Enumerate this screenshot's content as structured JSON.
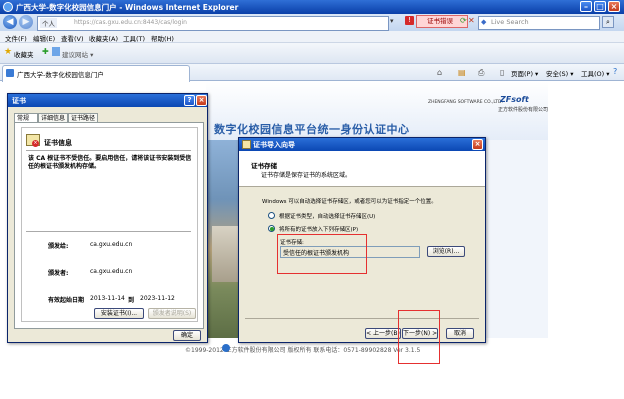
{
  "browser": {
    "title": "广西大学-数字化校园信息门户 - Windows Internet Explorer",
    "address_label": "个人",
    "address_url": "https://cas.gxu.edu.cn:8443/cas/login",
    "cert_error": "证书错误",
    "search_placeholder": "Live Search",
    "menu": [
      "文件(F)",
      "编辑(E)",
      "查看(V)",
      "收藏夹(A)",
      "工具(T)",
      "帮助(H)"
    ],
    "favorites_label": "收藏夹",
    "favorites_links": [
      "建议网站 ▾"
    ],
    "tab_title": "广西大学-数字化校园信息门户",
    "toolbar": [
      "页面(P) ▾",
      "安全(S) ▾",
      "工具(O) ▾"
    ]
  },
  "page": {
    "brand_en": "ZHENGFANG SOFTWARE CO.,LTD.",
    "brand_logo": "ZFsoft",
    "brand_cn": "正方软件股份有限公司",
    "title": "数字化校园信息平台统一身份认证中心",
    "footer": "©1999-2012  正方软件股份有限公司  版权所有  联系电话：0571-89902828  Ver 3.1.5"
  },
  "cert_dialog": {
    "title": "证书",
    "tabs": [
      "常规",
      "详细信息",
      "证书路径"
    ],
    "info_heading": "证书信息",
    "warning": "该 CA 根证书不受信任。要启用信任，请将该证书安装到受信任的根证书颁发机构存储。",
    "issued_to_label": "颁发给:",
    "issued_to_value": "ca.gxu.edu.cn",
    "issued_by_label": "颁发者:",
    "issued_by_value": "ca.gxu.edu.cn",
    "valid_label": "有效起始日期",
    "valid_from": "2013-11-14",
    "valid_to_label": "到",
    "valid_to": "2023-11-12",
    "install_button": "安装证书(I)...",
    "issuer_statement_button": "颁发者说明(S)",
    "ok_button": "确定"
  },
  "wizard": {
    "title": "证书导入向导",
    "heading": "证书存储",
    "subheading": "证书存储是保存证书的系统区域。",
    "description": "Windows 可以自动选择证书存储区，或者您可以为证书指定一个位置。",
    "option_auto": "根据证书类型，自动选择证书存储区(U)",
    "option_manual": "将所有的证书放入下列存储区(P)",
    "store_label": "证书存储:",
    "store_value": "受信任的根证书颁发机构",
    "browse_button": "浏览(R)...",
    "back_button": "< 上一步(B)",
    "next_button": "下一步(N) >",
    "cancel_button": "取消"
  }
}
